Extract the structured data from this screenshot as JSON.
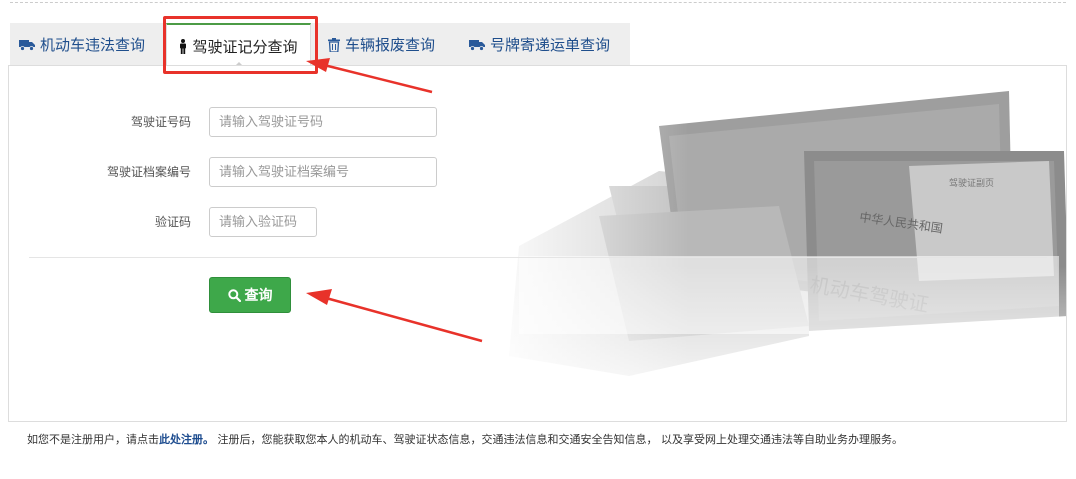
{
  "tabs": [
    {
      "label": "机动车违法查询",
      "icon": "truck-icon",
      "active": false
    },
    {
      "label": "驾驶证记分查询",
      "icon": "person-icon",
      "active": true
    },
    {
      "label": "车辆报废查询",
      "icon": "trash-icon",
      "active": false
    },
    {
      "label": "号牌寄递运单查询",
      "icon": "truck-icon",
      "active": false
    }
  ],
  "form": {
    "license_no": {
      "label": "驾驶证号码",
      "placeholder": "请输入驾驶证号码",
      "value": ""
    },
    "file_no": {
      "label": "驾驶证档案编号",
      "placeholder": "请输入驾驶证档案编号",
      "value": ""
    },
    "captcha": {
      "label": "验证码",
      "placeholder": "请输入验证码",
      "value": ""
    },
    "submit_label": "查询"
  },
  "footer": {
    "prefix": "如您不是注册用户，请点击",
    "link": "此处注册。",
    "suffix": " 注册后，您能获取您本人的机动车、驾驶证状态信息，交通违法信息和交通安全告知信息， 以及享受网上处理交通违法等自助业务办理服务。"
  },
  "colors": {
    "accent": "#3ea84a",
    "link": "#1d4c8f",
    "annotation": "#e8322a"
  }
}
